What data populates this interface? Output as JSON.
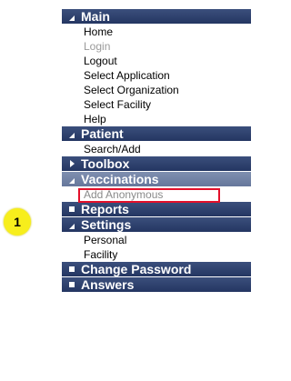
{
  "menu": {
    "main": {
      "title": "Main",
      "items": [
        "Home",
        "Login",
        "Logout",
        "Select Application",
        "Select Organization",
        "Select Facility",
        "Help"
      ]
    },
    "patient": {
      "title": "Patient",
      "items": [
        "Search/Add"
      ]
    },
    "toolbox": {
      "title": "Toolbox"
    },
    "vaccinations": {
      "title": "Vaccinations",
      "items": [
        "Add Anonymous"
      ]
    },
    "reports": {
      "title": "Reports"
    },
    "settings": {
      "title": "Settings",
      "items": [
        "Personal",
        "Facility"
      ]
    },
    "change_password": {
      "title": "Change Password"
    },
    "answers": {
      "title": "Answers"
    }
  },
  "callout": {
    "number": "1",
    "color": "#f7ee1c"
  },
  "colors": {
    "header": "#2e406c",
    "highlight_border": "#e3102a"
  }
}
